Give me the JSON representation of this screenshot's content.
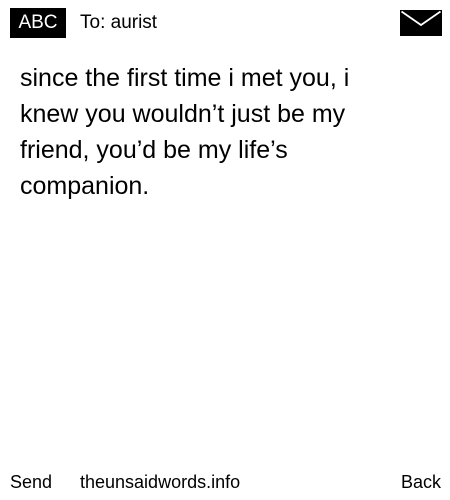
{
  "header": {
    "mode_label": "ABC",
    "recipient": "To: aurist",
    "icon": "envelope-icon"
  },
  "message": {
    "text": "since the first time i met you, i knew you wouldn’t just be my friend, you’d be my life’s companion."
  },
  "footer": {
    "left_softkey": "Send",
    "site": "theunsaidwords.info",
    "right_softkey": "Back"
  },
  "colors": {
    "background": "#ffffff",
    "text": "#000000",
    "badge_background": "#000000",
    "badge_text": "#ffffff"
  }
}
